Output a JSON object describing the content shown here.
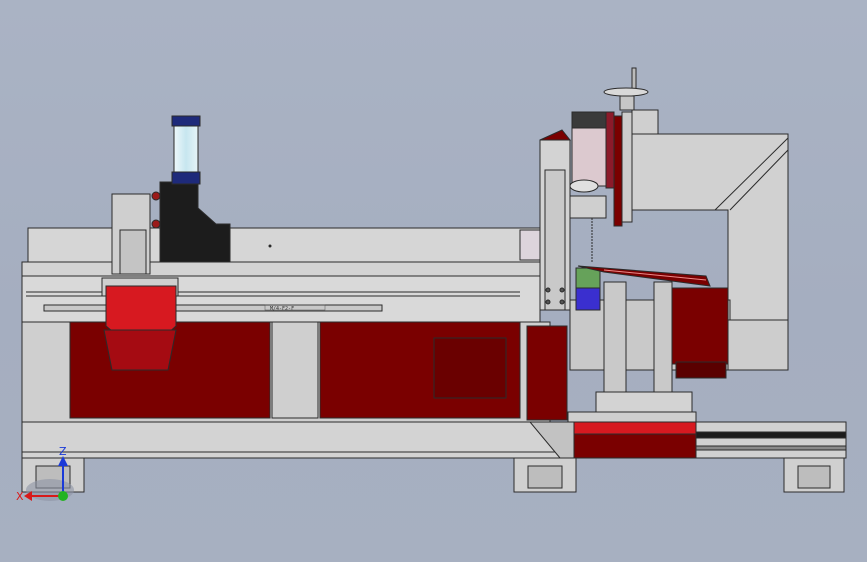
{
  "model_view": {
    "colors": {
      "background": "#a8b1c2",
      "frame_grey": "#d3d3d3",
      "frame_edge": "#2b2b2b",
      "panel_dark_red": "#7a0000",
      "panel_red": "#d71920",
      "post_black": "#1c1c1c",
      "motor_blue": "#3a2fcf",
      "glass_cyan": "#d6eef5"
    },
    "nameplate_text": "M/4-F2-F",
    "triad": {
      "z_label": "Z",
      "x_label": "X",
      "z_color": "#1a3ad8",
      "x_color": "#d81a1a",
      "origin_color": "#22b322"
    }
  }
}
